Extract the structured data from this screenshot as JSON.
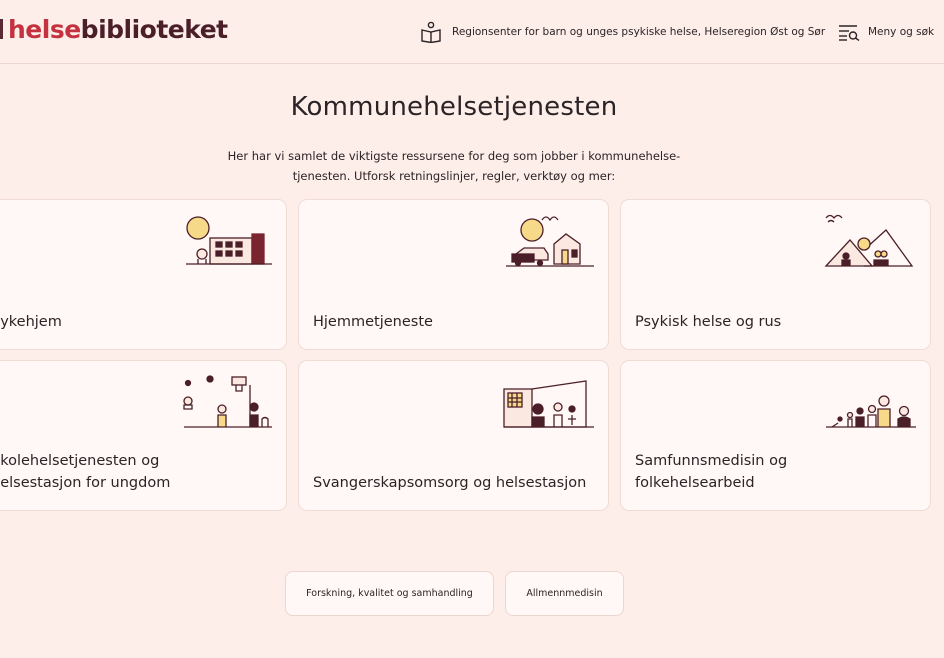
{
  "header": {
    "logo_part1": "helse",
    "logo_part2": "biblioteket",
    "region_text": "Regionsenter for barn og unges psykiske helse, Helseregion Øst og Sør",
    "menu_text": "Meny og søk"
  },
  "main": {
    "title": "Kommunehelsetjenesten",
    "intro_line1": "Her har vi samlet de viktigste ressursene for deg som jobber i kommunehelse-",
    "intro_line2": "tjenesten. Utforsk retningslinjer, regler, verktøy og mer:"
  },
  "cards": [
    {
      "line1": "Sykehjem",
      "line2": ""
    },
    {
      "line1": "Hjemmetjeneste",
      "line2": ""
    },
    {
      "line1": "Psykisk helse og rus",
      "line2": ""
    },
    {
      "line1": "Skolehelsetjenesten og",
      "line2": "helsestasjon for ungdom"
    },
    {
      "line1": "Svangerskapsomsorg og helsestasjon",
      "line2": ""
    },
    {
      "line1": "Samfunnsmedisin og",
      "line2": "folkehelsearbeid"
    }
  ],
  "pills": [
    {
      "label": "Forskning, kvalitet og samhandling"
    },
    {
      "label": "Allmennmedisin"
    }
  ],
  "colors": {
    "background": "#fdeee9",
    "card": "#fff8f6",
    "brand_red": "#c4323f",
    "brand_dark": "#4a1f28",
    "illustration_yellow": "#f7d98a"
  }
}
